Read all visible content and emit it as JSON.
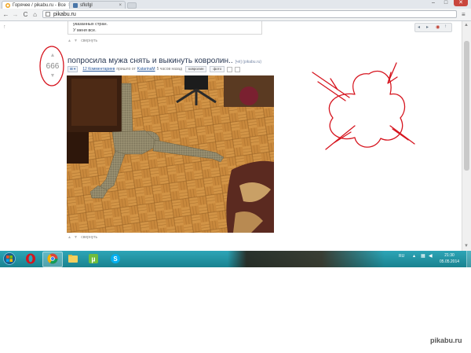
{
  "browser": {
    "tabs": [
      {
        "title": "Горячее / pikabu.ru - Все",
        "active": true
      },
      {
        "title": "sflofgl",
        "active": false
      }
    ],
    "url": "pikabu.ru",
    "window_controls": {
      "minimize": "–",
      "maximize": "□",
      "close": "✕"
    },
    "nav": {
      "back": "←",
      "forward": "→",
      "reload": "C",
      "home": "⌂"
    }
  },
  "prev_comment": {
    "lines": [
      "указанных стран.",
      "У меня все."
    ],
    "collapse_label": "свернуть"
  },
  "post": {
    "rating": "666",
    "title": "попросила мужа снять и выкинуть ковролин..",
    "title_suffix": "[чё] (pikabu.ru)",
    "comments_link": "12 Комментариев",
    "posted_by_label": "пришло от",
    "author": "KatarinaM",
    "time_ago": "5 часов назад",
    "tags": [
      "ковролин",
      "фото"
    ],
    "collapse_label": "свернуть"
  },
  "taskbar": {
    "lang": "RU",
    "time": "21:30",
    "date": "05.05.2014",
    "apps": [
      "start-orb",
      "opera",
      "chrome",
      "explorer",
      "utorrent",
      "skype"
    ]
  },
  "watermark": "pikabu.ru",
  "colors": {
    "taskbar": "#1e93a3",
    "annotation": "#d6141e",
    "link": "#2a5a9e",
    "floor": "#c78a3f"
  }
}
